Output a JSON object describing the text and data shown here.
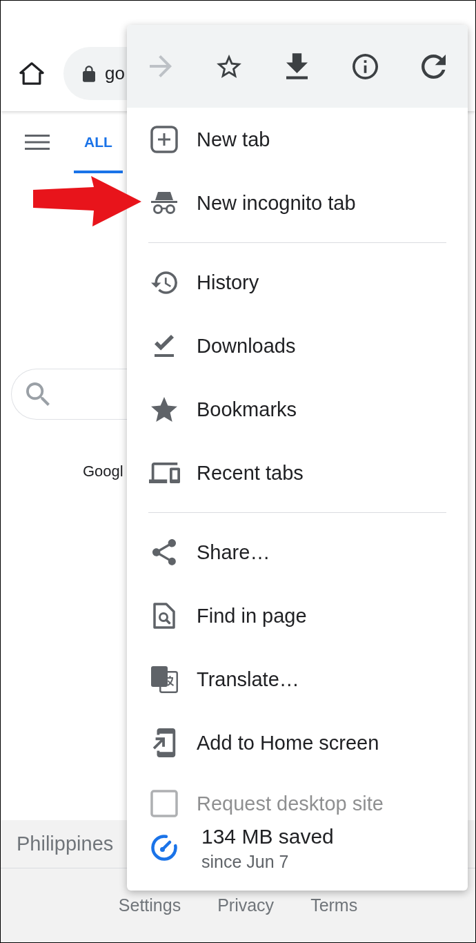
{
  "toolbar": {
    "url": "go"
  },
  "page": {
    "tabs": [
      {
        "label": "ALL",
        "selected": true
      }
    ],
    "caption": "Googl",
    "region": "Philippines",
    "footer_links": [
      "Settings",
      "Privacy",
      "Terms"
    ]
  },
  "menu": {
    "actions": [
      {
        "disabled": true
      },
      {
        "disabled": false
      },
      {
        "disabled": false
      },
      {
        "disabled": false
      },
      {
        "disabled": false
      }
    ],
    "groups": [
      [
        {
          "kind": "action",
          "label": "New tab",
          "annotated": false
        },
        {
          "kind": "action",
          "label": "New incognito tab",
          "annotated": true
        }
      ],
      [
        {
          "kind": "action",
          "label": "History",
          "annotated": false
        },
        {
          "kind": "action",
          "label": "Downloads",
          "annotated": false
        },
        {
          "kind": "action",
          "label": "Bookmarks",
          "annotated": false
        },
        {
          "kind": "action",
          "label": "Recent tabs",
          "annotated": false
        }
      ],
      [
        {
          "kind": "action",
          "label": "Share…",
          "annotated": false
        },
        {
          "kind": "action",
          "label": "Find in page",
          "annotated": false
        },
        {
          "kind": "action",
          "label": "Translate…",
          "annotated": false
        },
        {
          "kind": "action",
          "label": "Add to Home screen",
          "annotated": false
        },
        {
          "kind": "checkbox",
          "label": "Request desktop site",
          "checked": false,
          "annotated": false
        }
      ]
    ],
    "data_saver": {
      "amount": "134 MB saved",
      "since": "since Jun 7"
    }
  }
}
